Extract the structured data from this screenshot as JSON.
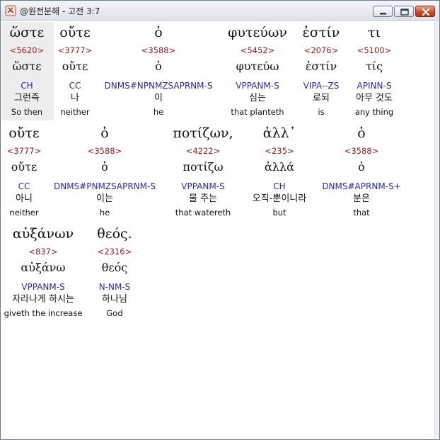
{
  "window": {
    "title": "@원전분해 - 고전 3:7",
    "app_icon": "bible-app-icon",
    "controls": {
      "minimize": "minimize-icon",
      "maximize": "maximize-icon",
      "close": "close-icon"
    },
    "accent_close": "#c8492c"
  },
  "colors": {
    "strong": "#9b1a1a",
    "parse": "#2a2aa8",
    "text": "#111111",
    "highlight": "#ededed"
  },
  "lines": [
    {
      "words": [
        {
          "greek": "ὥστε",
          "strong": "<5620>",
          "lemma": "ὥστε",
          "parse": "CH",
          "korean": "그런즉",
          "english": "So then",
          "selected": true
        },
        {
          "greek": "οὔτε",
          "strong": "<3777>",
          "lemma": "οὔτε",
          "parse": "CC",
          "korean": "나",
          "english": "neither"
        },
        {
          "greek": "ὁ",
          "strong": "<3588>",
          "lemma": "ὁ",
          "parse": "DNMS#NPNMZSAPRNM-S",
          "korean": "이",
          "english": "he"
        },
        {
          "greek": "φυτεύων",
          "strong": "<5452>",
          "lemma": "φυτεύω",
          "parse": "VPPANM-S",
          "korean": "심는",
          "english": "that planteth"
        },
        {
          "greek": "ἐστίν",
          "strong": "<2076>",
          "lemma": "ἐστίν",
          "parse": "VIPA--ZS",
          "korean": "로되",
          "english": "is"
        },
        {
          "greek": "τι",
          "strong": "<5100>",
          "lemma": "τίς",
          "parse": "APINN-S",
          "korean": "아무 것도",
          "english": "any thing"
        }
      ]
    },
    {
      "words": [
        {
          "greek": "οὔτε",
          "strong": "<3777>",
          "lemma": "οὔτε",
          "parse": "CC",
          "korean": "아니",
          "english": "neither"
        },
        {
          "greek": "ὁ",
          "strong": "<3588>",
          "lemma": "ὁ",
          "parse": "DNMS#PNMZSAPRNM-S",
          "korean": "이는",
          "english": "he"
        },
        {
          "greek": "ποτίζων,",
          "strong": "<4222>",
          "lemma": "ποτίζω",
          "parse": "VPPANM-S",
          "korean": "물 주는",
          "english": "that watereth"
        },
        {
          "greek": "ἀλλ᾽",
          "strong": "<235>",
          "lemma": "ἀλλά",
          "parse": "CH",
          "korean": "오직-뿐이니라",
          "english": "but"
        },
        {
          "greek": "ὁ",
          "strong": "<3588>",
          "lemma": "ὁ",
          "parse": "DNMS#APRNM-S+",
          "korean": "분은",
          "english": "that"
        }
      ]
    },
    {
      "words": [
        {
          "greek": "αὐξάνων",
          "strong": "<837>",
          "lemma": "αὐξάνω",
          "parse": "VPPANM-S",
          "korean": "자라나게 하시는",
          "english": "giveth the increase"
        },
        {
          "greek": "θεός.",
          "strong": "<2316>",
          "lemma": "θεός",
          "parse": "N-NM-S",
          "korean": "하나님",
          "english": "God"
        }
      ]
    }
  ]
}
